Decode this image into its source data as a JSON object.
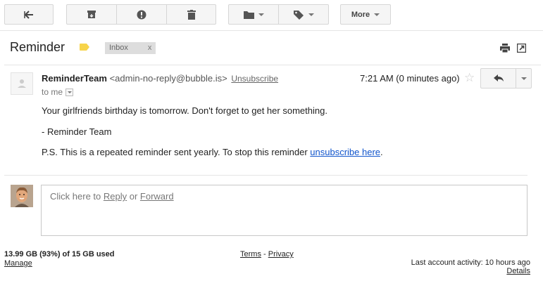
{
  "toolbar": {
    "back_icon": "arrow-left-icon",
    "archive_icon": "archive-icon",
    "spam_icon": "exclamation-icon",
    "delete_icon": "trash-icon",
    "move_icon": "folder-icon",
    "labels_icon": "tag-icon",
    "more_label": "More"
  },
  "message": {
    "subject": "Reminder",
    "label_color": "#f7d44a",
    "chip_label": "Inbox",
    "chip_close": "x",
    "sender_name": "ReminderTeam",
    "sender_email": "<admin-no-reply@bubble.is>",
    "unsubscribe_label": "Unsubscribe",
    "to_me": "to me",
    "time": "7:21 AM (0 minutes ago)",
    "body_line1": "Your girlfriends birthday is tomorrow. Don't forget to get her something.",
    "body_line2": "- Reminder Team",
    "body_line3_prefix": "P.S. This is a repeated reminder sent yearly. To stop this reminder ",
    "body_line3_link": "unsubscribe here",
    "body_line3_suffix": "."
  },
  "reply": {
    "prefix": "Click here to ",
    "reply_link": "Reply",
    "or": " or ",
    "forward_link": "Forward"
  },
  "footer": {
    "storage": "13.99 GB (93%) of 15 GB used",
    "manage": "Manage",
    "terms": "Terms",
    "sep": " - ",
    "privacy": "Privacy",
    "activity": "Last account activity: 10 hours ago",
    "details": "Details"
  },
  "colors": {
    "link_blue": "#1155cc",
    "button_bg": "#f5f5f5",
    "border": "#d6d6d6"
  }
}
